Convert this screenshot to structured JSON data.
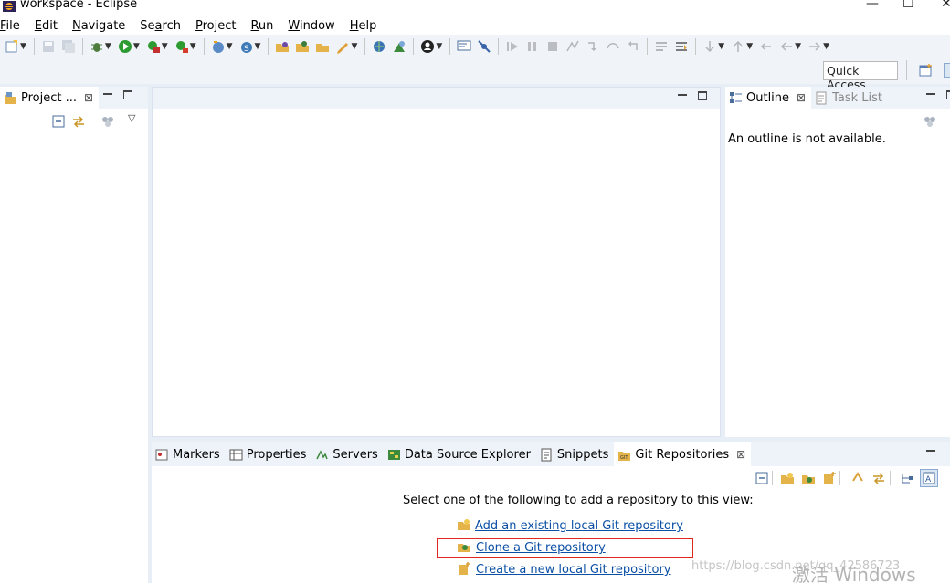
{
  "window": {
    "title": "workspace - Eclipse",
    "app_icon": "eclipse-icon",
    "controls": [
      "minimize",
      "maximize",
      "close"
    ]
  },
  "menu": [
    {
      "label": "File",
      "mnemonic": "F"
    },
    {
      "label": "Edit",
      "mnemonic": "E"
    },
    {
      "label": "Navigate",
      "mnemonic": "N"
    },
    {
      "label": "Search",
      "mnemonic": "a"
    },
    {
      "label": "Project",
      "mnemonic": "P"
    },
    {
      "label": "Run",
      "mnemonic": "R"
    },
    {
      "label": "Window",
      "mnemonic": "W"
    },
    {
      "label": "Help",
      "mnemonic": "H"
    }
  ],
  "quick_access": {
    "placeholder": "Quick Access"
  },
  "project_explorer": {
    "tab_label": "Project ...",
    "close": "⊠"
  },
  "editor": {},
  "outline": {
    "tabs": [
      {
        "label": "Outline",
        "active": true,
        "close": "⊠"
      },
      {
        "label": "Task List",
        "active": false
      }
    ],
    "message": "An outline is not available."
  },
  "bottom_panel": {
    "tabs": [
      {
        "label": "Markers",
        "icon": "markers-icon"
      },
      {
        "label": "Properties",
        "icon": "properties-icon"
      },
      {
        "label": "Servers",
        "icon": "servers-icon"
      },
      {
        "label": "Data Source Explorer",
        "icon": "data-source-icon"
      },
      {
        "label": "Snippets",
        "icon": "snippets-icon"
      },
      {
        "label": "Git Repositories",
        "icon": "git-icon",
        "active": true,
        "close": "⊠"
      }
    ],
    "instruction": "Select one of the following to add a repository to this view:",
    "links": [
      {
        "label": "Add an existing local Git repository",
        "icon": "add-repo-icon"
      },
      {
        "label": "Clone a Git repository",
        "icon": "clone-repo-icon",
        "highlighted": true
      },
      {
        "label": "Create a new local Git repository",
        "icon": "new-repo-icon"
      }
    ],
    "highlight_color": "#e0271e"
  },
  "watermarks": {
    "blog": "https://blog.csdn.net/qq_42586723",
    "windows": "激活 Windows"
  },
  "colors": {
    "background": "#e8eef5",
    "panel_header": "#eef3f9",
    "link": "#0b50a6"
  }
}
